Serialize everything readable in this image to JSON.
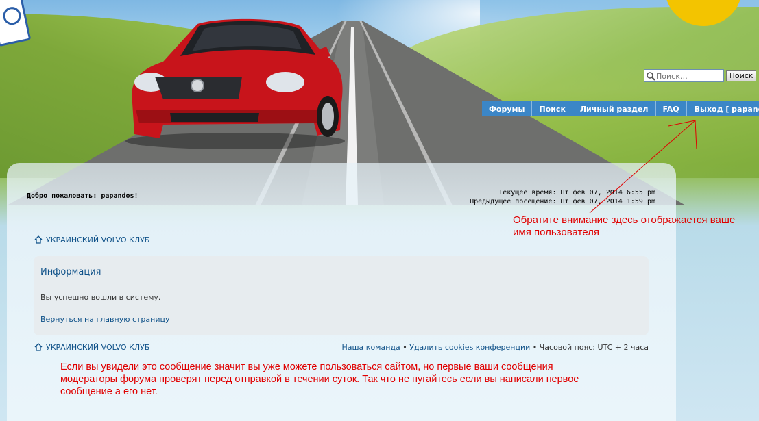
{
  "search": {
    "placeholder": "Поиск…",
    "button_label": "Поиск"
  },
  "nav": {
    "items": [
      {
        "label": "Форумы"
      },
      {
        "label": "Поиск"
      },
      {
        "label": "Личный раздел"
      },
      {
        "label": "FAQ"
      },
      {
        "label": "Выход [ papandos ]"
      }
    ]
  },
  "welcome": "Добро пожаловать: papandos!",
  "times": {
    "current": "Текущее время: Пт фев 07, 2014 6:55 pm",
    "previous": "Предыдущее посещение: Пт фев 07, 2014 1:59 pm"
  },
  "breadcrumb": "УКРАИНСКИЙ VOLVO КЛУБ",
  "info": {
    "title": "Информация",
    "message": "Вы успешно вошли в систему.",
    "return_link": "Вернуться на главную страницу"
  },
  "footer": {
    "team_link": "Наша команда",
    "separator": " • ",
    "delete_cookies_link": "Удалить cookies конференции",
    "timezone": "Часовой пояс: UTC + 2 часа"
  },
  "annotations": {
    "username_note": "Обратите внимание здесь отображается ваше имя пользователя",
    "moderation_note": "Если вы увидели это сообщение значит вы уже можете пользоваться сайтом, но первые ваши сообщения модераторы форума проверят перед отправкой в течении суток. Так что не пугайтесь если вы написали первое сообщение а его нет."
  },
  "colors": {
    "nav_bg": "#3b86c7",
    "link": "#105289",
    "annotation": "#e00000"
  }
}
